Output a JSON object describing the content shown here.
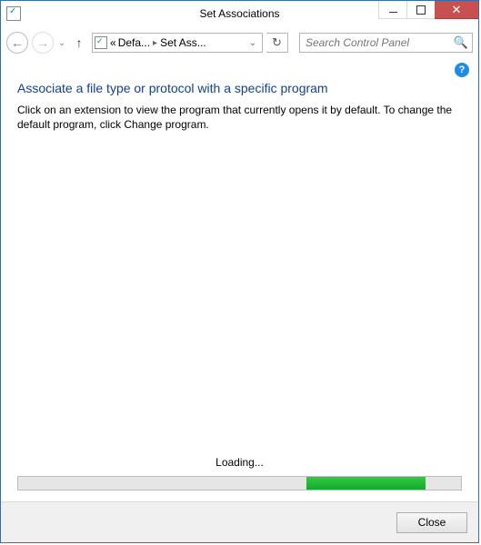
{
  "window": {
    "title": "Set Associations"
  },
  "breadcrumb": {
    "prefix": "«",
    "seg1": "Defa...",
    "seg2": "Set Ass..."
  },
  "search": {
    "placeholder": "Search Control Panel"
  },
  "content": {
    "heading": "Associate a file type or protocol with a specific program",
    "description": "Click on an extension to view the program that currently opens it by default. To change the default program, click Change program.",
    "loading_label": "Loading..."
  },
  "footer": {
    "close_label": "Close"
  },
  "icons": {
    "help": "?"
  }
}
